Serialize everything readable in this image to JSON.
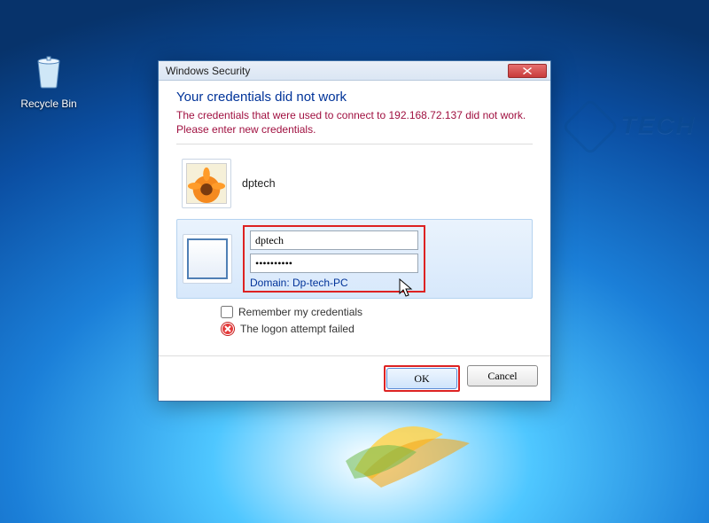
{
  "desktop": {
    "recycle_bin_label": "Recycle Bin",
    "watermark": "TECH"
  },
  "dialog": {
    "title": "Windows Security",
    "heading": "Your credentials did not work",
    "error_msg": "The credentials that were used to connect to 192.168.72.137 did not work. Please enter new credentials.",
    "saved_user": "dptech",
    "username_value": "dptech",
    "password_value": "••••••••••",
    "domain_label": "Domain: Dp-tech-PC",
    "remember_label": "Remember my credentials",
    "fail_label": "The logon attempt failed",
    "ok_label": "OK",
    "cancel_label": "Cancel"
  }
}
